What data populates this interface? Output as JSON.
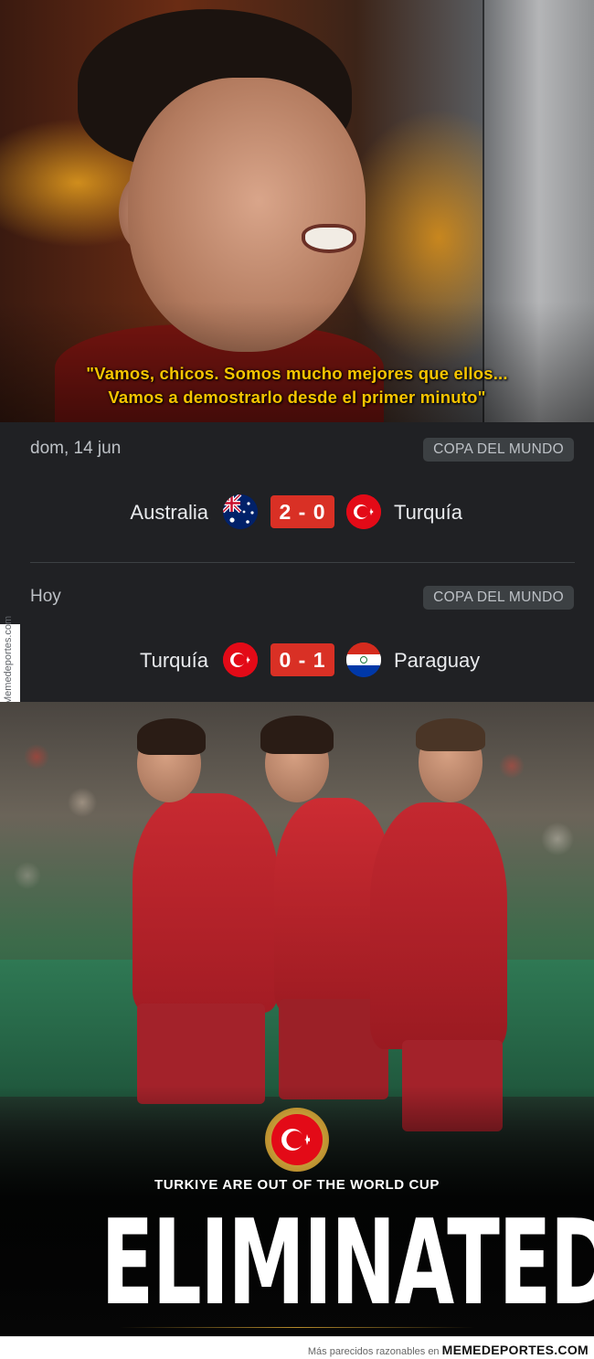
{
  "caption": {
    "line1": "\"Vamos, chicos. Somos mucho mejores que ellos...",
    "line2": "Vamos a demostrarlo desde el primer minuto\""
  },
  "matches": [
    {
      "date": "dom, 14 jun",
      "competition": "COPA DEL MUNDO",
      "home": "Australia",
      "home_flag": "australia-flag-icon",
      "score": "2 - 0",
      "away": "Turquía",
      "away_flag": "turkey-flag-icon"
    },
    {
      "date": "Hoy",
      "competition": "COPA DEL MUNDO",
      "home": "Turquía",
      "home_flag": "turkey-flag-icon",
      "score": "0 - 1",
      "away": "Paraguay",
      "away_flag": "paraguay-flag-icon"
    }
  ],
  "side_watermark": "Memedeportes.com",
  "poster": {
    "tagline": "TURKIYE ARE OUT OF THE WORLD CUP",
    "headline": "ELIMINATED",
    "emblem_icon": "turkey-crest-icon"
  },
  "footer": {
    "text": "Más parecidos razonables en",
    "brand": "MEMEDEPORTES.COM"
  },
  "colors": {
    "caption": "#f6c400",
    "score_bg": "#d93025",
    "panel_bg": "#202124",
    "turkey_red": "#e30a17"
  }
}
